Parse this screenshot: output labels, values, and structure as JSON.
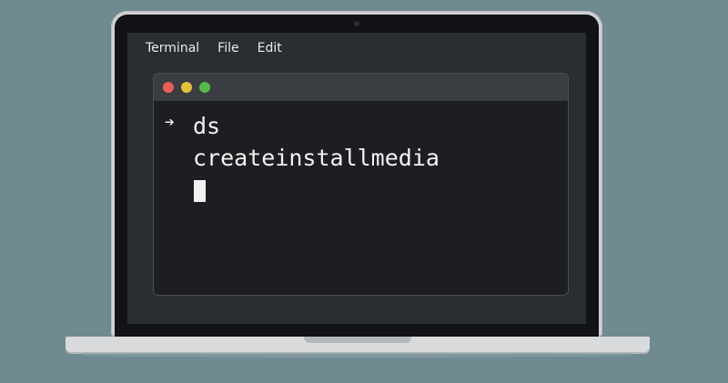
{
  "menubar": {
    "items": [
      "Terminal",
      "File",
      "Edit"
    ]
  },
  "terminal": {
    "traffic_lights": [
      {
        "name": "close",
        "color": "#ec5f57"
      },
      {
        "name": "minimize",
        "color": "#e5c23e"
      },
      {
        "name": "zoom",
        "color": "#56b848"
      }
    ],
    "prompt_glyph": "➔",
    "command_line_1": "ds",
    "command_line_2": "createinstallmedia"
  },
  "colors": {
    "background": "#6f8a91",
    "terminal_bg": "#1c1e21",
    "text": "#f2f2f2"
  }
}
